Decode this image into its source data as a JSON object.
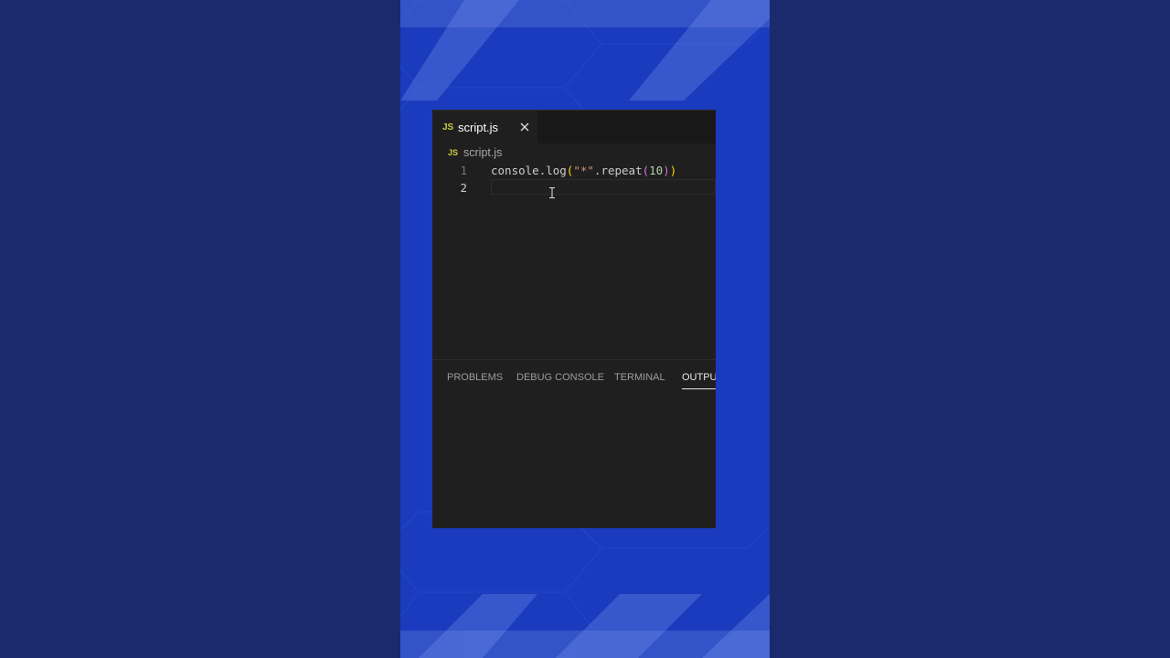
{
  "editor": {
    "tab": {
      "icon": "js-file-icon",
      "badge": "JS",
      "label": "script.js"
    },
    "breadcrumb": {
      "badge": "JS",
      "label": "script.js"
    },
    "lines": [
      {
        "number": "1"
      },
      {
        "number": "2"
      }
    ],
    "code_line1": {
      "ident1": "console",
      "dot1": ".",
      "ident2": "log",
      "paren_open1": "(",
      "string": "\"*\"",
      "dot2": ".",
      "ident3": "repeat",
      "paren_open2": "(",
      "number": "10",
      "paren_close2": ")",
      "paren_close1": ")"
    }
  },
  "panel": {
    "tabs": [
      {
        "label": "PROBLEMS",
        "active": false
      },
      {
        "label": "DEBUG CONSOLE",
        "active": false
      },
      {
        "label": "TERMINAL",
        "active": false
      },
      {
        "label": "OUTPUT",
        "active": true
      }
    ]
  },
  "colors": {
    "page_background": "#1a2a6d",
    "center_background": "#1a3bbd",
    "editor_background": "#1f1f1f",
    "js_badge": "#cbcb41"
  }
}
